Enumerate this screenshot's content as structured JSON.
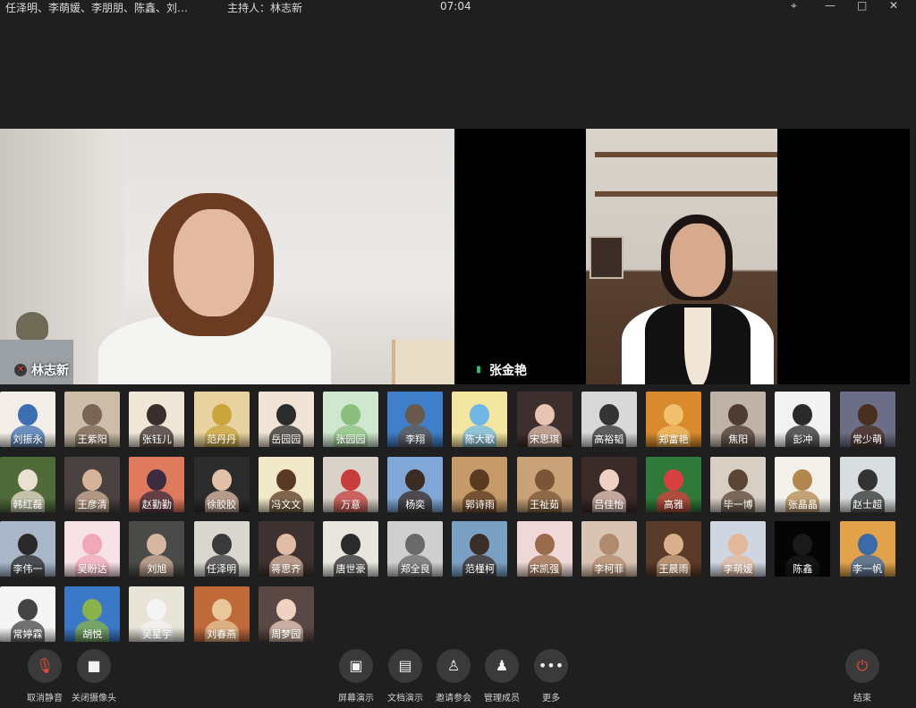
{
  "window": {
    "participants_title": "任泽明、李萌媛、李朋朋、陈鑫、刘…",
    "host": "主持人：林志新",
    "clock": "07:04",
    "controls": [
      "⌖",
      "—",
      "□",
      "✕"
    ]
  },
  "stage": {
    "left_name": "林志新",
    "right_name": "张金艳"
  },
  "participants": [
    {
      "name": "刘振永",
      "color": "#f3efe8",
      "accent": "#3c6fb1"
    },
    {
      "name": "王紫阳",
      "color": "#cbbda8",
      "accent": "#7a6453"
    },
    {
      "name": "张钰儿",
      "color": "#efe6d8",
      "accent": "#3a2e2a"
    },
    {
      "name": "范丹丹",
      "color": "#e7d2a0",
      "accent": "#c9a43b"
    },
    {
      "name": "岳园园",
      "color": "#f1e4d6",
      "accent": "#2b2b2b"
    },
    {
      "name": "张园园",
      "color": "#cfe6cf",
      "accent": "#8cbf7f"
    },
    {
      "name": "李翔",
      "color": "#3f7ec8",
      "accent": "#6a5a4c"
    },
    {
      "name": "陈大歌",
      "color": "#f2e6a0",
      "accent": "#6fb7e6"
    },
    {
      "name": "宋思琪",
      "color": "#3c2f2d",
      "accent": "#e8c5b2"
    },
    {
      "name": "高裕韬",
      "color": "#d8d8d8",
      "accent": "#333333"
    },
    {
      "name": "郑富艳",
      "color": "#d88a2c",
      "accent": "#f0c06a"
    },
    {
      "name": "焦阳",
      "color": "#bfb3a8",
      "accent": "#4d3b34"
    },
    {
      "name": "彭冲",
      "color": "#f2f2f2",
      "accent": "#2a2a2a"
    },
    {
      "name": "常少萌",
      "color": "#6b6e86",
      "accent": "#4a2f20"
    },
    {
      "name": "韩红磊",
      "color": "#4f6b3a",
      "accent": "#e9e0d0"
    },
    {
      "name": "王彦清",
      "color": "#4a4240",
      "accent": "#d6b49a"
    },
    {
      "name": "赵勤勤",
      "color": "#e07a5f",
      "accent": "#3d2b3e"
    },
    {
      "name": "徐胶胶",
      "color": "#2c2c2c",
      "accent": "#e3c0a8"
    },
    {
      "name": "冯文文",
      "color": "#f1e9c7",
      "accent": "#5a3a24"
    },
    {
      "name": "万意",
      "color": "#d8d2c8",
      "accent": "#c83c3c"
    },
    {
      "name": "杨奕",
      "color": "#7fa8d8",
      "accent": "#3b2b24"
    },
    {
      "name": "郭诗雨",
      "color": "#c79a6a",
      "accent": "#5a3a22"
    },
    {
      "name": "王祉茹",
      "color": "#c9a27a",
      "accent": "#7b5634"
    },
    {
      "name": "吕佳怡",
      "color": "#3a2a2a",
      "accent": "#f0d2c4"
    },
    {
      "name": "高雅",
      "color": "#2f7a3a",
      "accent": "#d94040"
    },
    {
      "name": "毕一博",
      "color": "#d7cfc4",
      "accent": "#5b4636"
    },
    {
      "name": "张晶晶",
      "color": "#f4f1ea",
      "accent": "#b4874e"
    },
    {
      "name": "赵士超",
      "color": "#d8dde0",
      "accent": "#333333"
    },
    {
      "name": "李伟一",
      "color": "#a9b6c9",
      "accent": "#2a2a2a"
    },
    {
      "name": "吴盼达",
      "color": "#f7e2e6",
      "accent": "#f0a7b8"
    },
    {
      "name": "刘旭",
      "color": "#4a4a48",
      "accent": "#d8b7a0"
    },
    {
      "name": "任泽明",
      "color": "#dad7d0",
      "accent": "#3a3a3a"
    },
    {
      "name": "蒋思齐",
      "color": "#3d3230",
      "accent": "#e1bda5"
    },
    {
      "name": "唐世豪",
      "color": "#e8e4de",
      "accent": "#2b2b2b"
    },
    {
      "name": "郑全良",
      "color": "#cfcfcf",
      "accent": "#6a6a6a"
    },
    {
      "name": "范槿柯",
      "color": "#7aa0c4",
      "accent": "#3b2e28"
    },
    {
      "name": "宋凯强",
      "color": "#f0d8d8",
      "accent": "#9a6a4a"
    },
    {
      "name": "李柯菲",
      "color": "#d9c4b4",
      "accent": "#b08a6c"
    },
    {
      "name": "王晨雨",
      "color": "#5a3a28",
      "accent": "#d9b08c"
    },
    {
      "name": "李萌媛",
      "color": "#cfd6e2",
      "accent": "#e4b79a"
    },
    {
      "name": "陈鑫",
      "color": "#050505",
      "accent": "#1a1a1a"
    },
    {
      "name": "李一帆",
      "color": "#e2a24a",
      "accent": "#3a6aa8"
    },
    {
      "name": "常婷霖",
      "color": "#f5f5f5",
      "accent": "#444444"
    },
    {
      "name": "胡悦",
      "color": "#3c78c8",
      "accent": "#8ab34a"
    },
    {
      "name": "吴星宇",
      "color": "#e8e4d8",
      "accent": "#f4f4f4"
    },
    {
      "name": "刘春燕",
      "color": "#c06a3a",
      "accent": "#e8c89a"
    },
    {
      "name": "周梦园",
      "color": "#5a4844",
      "accent": "#efd2c0"
    }
  ],
  "toolbar": {
    "unmute": "取消静音",
    "camera_off": "关闭摄像头",
    "screen_share": "屏幕演示",
    "doc_share": "文档演示",
    "invite": "邀请参会",
    "manage": "管理成员",
    "more": "更多",
    "end": "结束"
  },
  "icons": {
    "mic_muted": "mic-slash",
    "camera": "video-camera",
    "screen": "monitor-share",
    "doc": "folder-share",
    "invite": "person-plus",
    "manage": "people",
    "more": "ellipsis",
    "end": "power"
  }
}
